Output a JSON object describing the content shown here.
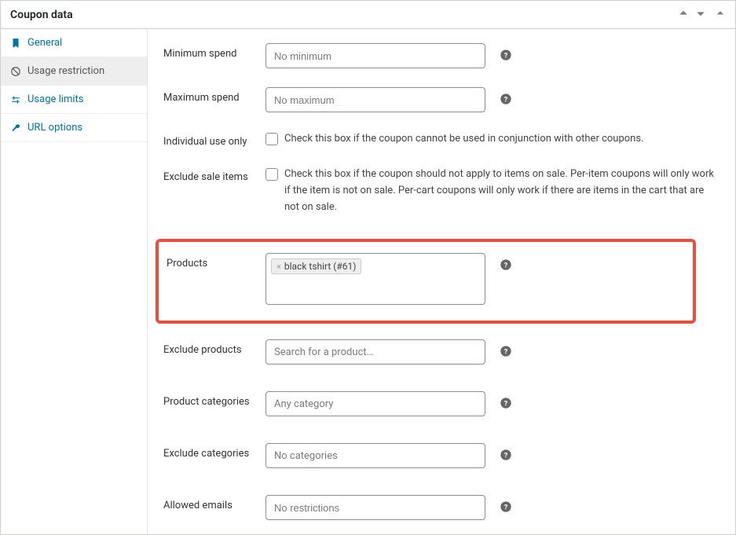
{
  "panel": {
    "title": "Coupon data"
  },
  "sidebar": {
    "items": [
      {
        "label": "General"
      },
      {
        "label": "Usage restriction"
      },
      {
        "label": "Usage limits"
      },
      {
        "label": "URL options"
      }
    ]
  },
  "fields": {
    "minimum_spend": {
      "label": "Minimum spend",
      "placeholder": "No minimum"
    },
    "maximum_spend": {
      "label": "Maximum spend",
      "placeholder": "No maximum"
    },
    "individual_use": {
      "label": "Individual use only",
      "description": "Check this box if the coupon cannot be used in conjunction with other coupons."
    },
    "exclude_sale": {
      "label": "Exclude sale items",
      "description": "Check this box if the coupon should not apply to items on sale. Per-item coupons will only work if the item is not on sale. Per-cart coupons will only work if there are items in the cart that are not on sale."
    },
    "products": {
      "label": "Products",
      "tag": "black tshirt (#61)"
    },
    "exclude_products": {
      "label": "Exclude products",
      "placeholder": "Search for a product…"
    },
    "product_categories": {
      "label": "Product categories",
      "placeholder": "Any category"
    },
    "exclude_categories": {
      "label": "Exclude categories",
      "placeholder": "No categories"
    },
    "allowed_emails": {
      "label": "Allowed emails",
      "placeholder": "No restrictions"
    }
  }
}
